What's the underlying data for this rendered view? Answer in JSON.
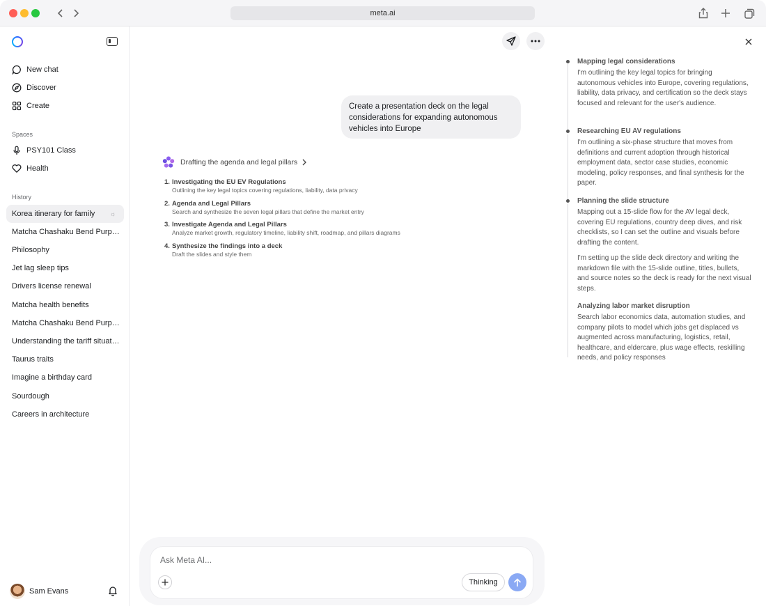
{
  "browser": {
    "url": "meta.ai"
  },
  "sidebar": {
    "nav": [
      {
        "label": "New chat",
        "icon": "chat-bubble-icon"
      },
      {
        "label": "Discover",
        "icon": "compass-icon"
      },
      {
        "label": "Create",
        "icon": "grid-icon"
      }
    ],
    "spaces_label": "Spaces",
    "spaces": [
      {
        "label": "PSY101 Class",
        "icon": "microphone-icon"
      },
      {
        "label": "Health",
        "icon": "heart-icon"
      }
    ],
    "history_label": "History",
    "history": [
      "Korea itinerary for family",
      "Matcha Chashaku Bend Purpose",
      "Philosophy",
      "Jet lag sleep tips",
      "Drivers license renewal",
      "Matcha health benefits",
      "Matcha Chashaku Bend Purpose",
      "Understanding the tariff situation",
      "Taurus traits",
      "Imagine a birthday card",
      "Sourdough",
      "Careers in architecture"
    ],
    "user": {
      "name": "Sam Evans"
    }
  },
  "chat": {
    "user_message": "Create a presentation deck on the legal considerations for expanding autonomous vehicles into Europe",
    "status": "Drafting the agenda and legal pillars",
    "steps": [
      {
        "num": "1.",
        "title": "Investigating the EU EV Regulations",
        "sub": "Outlining the key legal topics covering regulations, liability, data privacy"
      },
      {
        "num": "2.",
        "title": "Agenda and Legal Pillars",
        "sub": "Search and synthesize the seven legal pillars that define the market entry"
      },
      {
        "num": "3.",
        "title": "Investigate Agenda and Legal Pillars",
        "sub": "Analyze market growth, regulatory timeline, liability shift, roadmap, and pillars diagrams"
      },
      {
        "num": "4.",
        "title": "Synthesize the findings into a deck",
        "sub": "Draft the slides and style them"
      }
    ]
  },
  "composer": {
    "placeholder": "Ask Meta AI...",
    "thinking_label": "Thinking"
  },
  "timeline": [
    {
      "title": "Mapping legal considerations",
      "body": "I'm outlining the key legal topics for bringing autonomous vehicles into Europe, covering regulations, liability, data privacy, and certification so the deck stays focused and relevant for the user's audience."
    },
    {
      "title": "Researching EU AV regulations",
      "body": "I'm outlining a six-phase structure that moves from definitions and current adoption through historical employment data, sector case studies, economic modeling, policy responses, and final synthesis for the paper."
    },
    {
      "title": "Planning the slide structure",
      "body": "Mapping out a 15-slide flow for the AV legal deck, covering EU regulations, country deep dives, and risk checklists, so I can set the outline and visuals before drafting the content."
    },
    {
      "title": "",
      "body": "I'm setting up the slide deck directory and writing the markdown file with the 15-slide outline, titles, bullets, and source notes so the deck is ready for the next visual steps."
    },
    {
      "title": "Analyzing labor market disruption",
      "body": "Search labor economics data, automation studies, and company pilots to model which jobs get displaced vs augmented across manufacturing, logistics, retail, healthcare, and eldercare, plus wage effects, reskilling needs, and policy responses"
    }
  ]
}
